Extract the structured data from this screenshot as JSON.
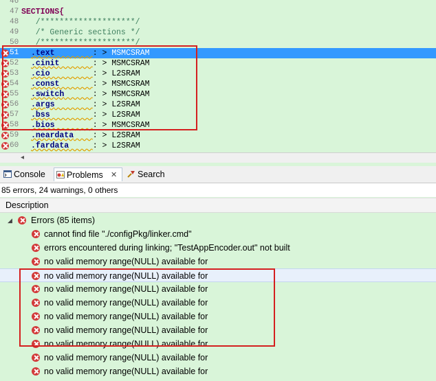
{
  "editor": {
    "lines": [
      {
        "num": "46",
        "text": "",
        "style": "plain",
        "error": false
      },
      {
        "num": "47",
        "text": "SECTIONS{",
        "style": "kw",
        "error": false
      },
      {
        "num": "48",
        "text": "   /********************/",
        "style": "cm",
        "error": false
      },
      {
        "num": "49",
        "text": "   /* Generic sections */",
        "style": "cm",
        "error": false
      },
      {
        "num": "50",
        "text": "   /********************/",
        "style": "cm",
        "error": false
      },
      {
        "num": "51",
        "sym": ".text",
        "target": "MSMCSRAM",
        "style": "sec",
        "error": true,
        "selected": true
      },
      {
        "num": "52",
        "sym": ".cinit",
        "target": "MSMCSRAM",
        "style": "sec",
        "error": true
      },
      {
        "num": "53",
        "sym": ".cio",
        "target": "L2SRAM",
        "style": "sec",
        "error": true
      },
      {
        "num": "54",
        "sym": ".const",
        "target": "MSMCSRAM",
        "style": "sec",
        "error": true
      },
      {
        "num": "55",
        "sym": ".switch",
        "target": "MSMCSRAM",
        "style": "sec",
        "error": true
      },
      {
        "num": "56",
        "sym": ".args",
        "target": "L2SRAM",
        "style": "sec",
        "error": true
      },
      {
        "num": "57",
        "sym": ".bss",
        "target": "L2SRAM",
        "style": "sec",
        "error": true
      },
      {
        "num": "58",
        "sym": ".bios",
        "target": "MSMCSRAM",
        "style": "sec",
        "error": true
      },
      {
        "num": "59",
        "sym": ".neardata",
        "target": "L2SRAM",
        "style": "sec",
        "error": true
      },
      {
        "num": "60",
        "sym": ".fardata",
        "target": "L2SRAM",
        "style": "sec",
        "error": true
      }
    ],
    "separator": ": >"
  },
  "tabs": [
    {
      "label": "Console",
      "icon": "console-icon",
      "active": false
    },
    {
      "label": "Problems",
      "icon": "problems-icon",
      "active": true,
      "close": "✕"
    },
    {
      "label": "Search",
      "icon": "search-icon",
      "active": false
    }
  ],
  "problems": {
    "summary": "85 errors, 24 warnings, 0 others",
    "column_header": "Description",
    "group": {
      "label": "Errors (85 items)",
      "twisty": "◢"
    },
    "items": [
      "cannot find file \"./configPkg/linker.cmd\"",
      "errors encountered during linking; \"TestAppEncoder.out\" not built",
      "no valid memory range(NULL) available for",
      "no valid memory range(NULL) available for",
      "no valid memory range(NULL) available for",
      "no valid memory range(NULL) available for",
      "no valid memory range(NULL) available for",
      "no valid memory range(NULL) available for",
      "no valid memory range(NULL) available for",
      "no valid memory range(NULL) available for",
      "no valid memory range(NULL) available for"
    ]
  },
  "colors": {
    "error": "#d23a3a",
    "highlight_box": "#d41f1f",
    "selection": "#3399ff",
    "background": "#d9f5d9"
  }
}
